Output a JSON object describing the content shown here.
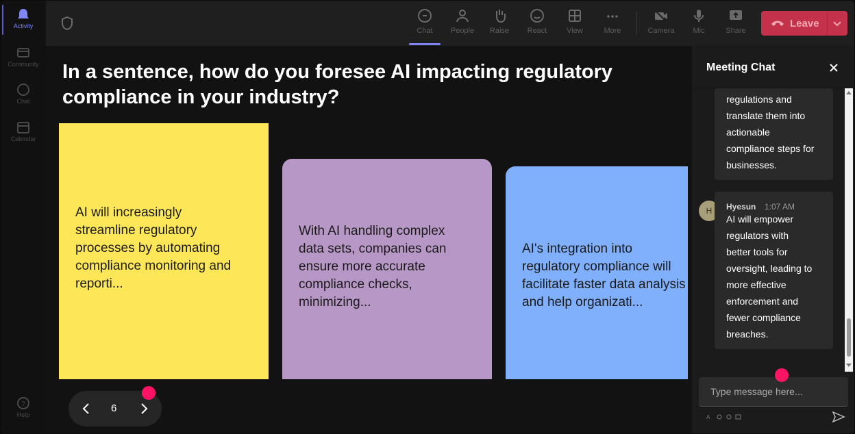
{
  "rail": {
    "items": [
      {
        "label": "Activity",
        "icon": "bell-icon",
        "active": true
      },
      {
        "label": "Community",
        "icon": "community-icon"
      },
      {
        "label": "Chat",
        "icon": "chat-icon"
      },
      {
        "label": "Calendar",
        "icon": "calendar-icon"
      }
    ],
    "help": {
      "label": "Help",
      "icon": "help-icon"
    }
  },
  "toolbar": {
    "chat": "Chat",
    "people": "People",
    "raise": "Raise",
    "react": "React",
    "view": "View",
    "more": "More",
    "camera": "Camera",
    "mic": "Mic",
    "share": "Share",
    "leave": "Leave"
  },
  "stage": {
    "question_line1": "In a sentence, how do you foresee AI impacting regulatory",
    "question_line2": "compliance in your industry?",
    "cards": [
      {
        "color": "#fde759",
        "lines": [
          "AI will increasingly",
          "streamline regulatory",
          "processes by automating",
          "compliance monitoring and",
          "reporti..."
        ]
      },
      {
        "color": "#b797c5",
        "lines": [
          "With AI handling complex",
          "data sets, companies can",
          "ensure more accurate",
          "compliance checks,",
          "minimizing..."
        ]
      },
      {
        "color": "#80b0fb",
        "lines": [
          "AI's integration into",
          "regulatory compliance will",
          "facilitate faster data analysis",
          "and help organizati..."
        ]
      }
    ],
    "pager": {
      "page": "6"
    }
  },
  "chat": {
    "title": "Meeting Chat",
    "messages": [
      {
        "lines": [
          "regulations and",
          "translate them into",
          "actionable",
          "compliance steps for",
          "businesses."
        ]
      },
      {
        "sender": "Hyesun",
        "initial": "H",
        "time": "1:07 AM",
        "lines": [
          "AI will empower",
          "regulators with",
          "better tools for",
          "oversight, leading to",
          "more effective",
          "enforcement and",
          "fewer compliance",
          "breaches."
        ]
      }
    ],
    "input_placeholder": "Type message here..."
  },
  "colors": {
    "accent": "#7f85f5",
    "leave": "#c4314b",
    "notification_dot": "#ff1463"
  }
}
